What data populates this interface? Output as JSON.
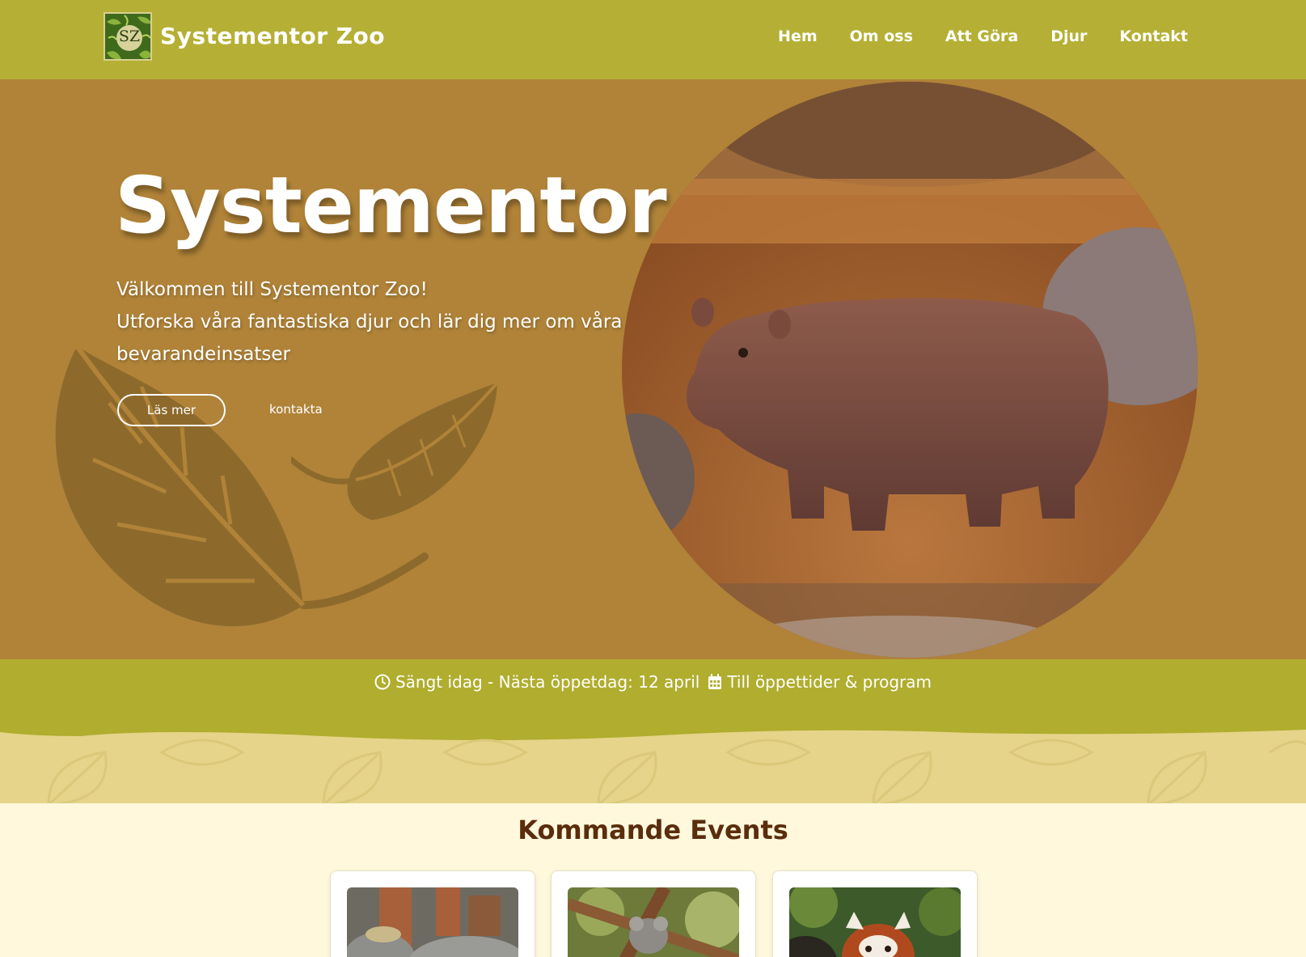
{
  "header": {
    "logo_text": "SZ",
    "brand": "Systementor Zoo",
    "nav": [
      {
        "label": "Hem"
      },
      {
        "label": "Om oss"
      },
      {
        "label": "Att Göra"
      },
      {
        "label": "Djur"
      },
      {
        "label": "Kontakt"
      }
    ]
  },
  "hero": {
    "title": "Systementor Zoo",
    "line1": "Välkommen till Systementor Zoo!",
    "line2": "Utforska våra fantastiska djur och lär dig mer om våra bevarandeinsatser",
    "button_label": "Läs mer",
    "link_label": "kontakta",
    "photo_icon": "hippo-photo"
  },
  "info": {
    "status_icon": "clock-icon",
    "status_text": "Sängt idag - Nästa öppetdag: 12 april",
    "link_icon": "calendar-icon",
    "link_text": "Till öppettider & program"
  },
  "events": {
    "title": "Kommande Events",
    "cards": [
      {
        "image": "elephants-photo"
      },
      {
        "image": "koala-photo"
      },
      {
        "image": "red-panda-photo"
      }
    ]
  },
  "colors": {
    "header_bg": "#b5b035",
    "hero_bg": "#b08338",
    "strip_bg": "#b0ad2f",
    "wave_bg": "#e6d48a",
    "section_bg": "#fff8dc",
    "title_color": "#5a2d0c"
  }
}
